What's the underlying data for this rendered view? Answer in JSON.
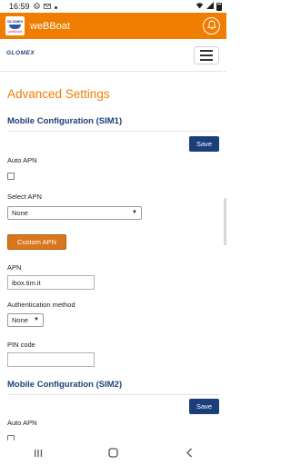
{
  "status_bar": {
    "time": "16:59",
    "notification_icons": [
      "whatsapp-icon",
      "mail-icon",
      "dot-icon"
    ],
    "system_icons": [
      "wifi-icon",
      "signal-icon",
      "battery-icon"
    ]
  },
  "app_bar": {
    "logo_text_top": "GLOMEX",
    "logo_text_bottom": "weBBoat",
    "title": "weBBoat",
    "bell_icon": "bell-icon",
    "color": "#ef7d00"
  },
  "page_header": {
    "brand": "GLOMEX",
    "menu_icon": "hamburger-menu-icon"
  },
  "page": {
    "title": "Advanced Settings",
    "sim1": {
      "title": "Mobile Configuration (SIM1)",
      "save_label": "Save",
      "auto_apn_label": "Auto APN",
      "auto_apn_checked": false,
      "select_apn_label": "Select APN",
      "select_apn_value": "None",
      "custom_apn_button": "Custom APN",
      "apn_label": "APN",
      "apn_value": "ibox.tim.it",
      "auth_label": "Authentication method",
      "auth_value": "None",
      "pin_label": "PIN code",
      "pin_value": ""
    },
    "sim2": {
      "title": "Mobile Configuration (SIM2)",
      "save_label": "Save",
      "auto_apn_label": "Auto APN",
      "auto_apn_checked": false
    }
  },
  "nav_bar": {
    "icons": [
      "recent-apps-icon",
      "home-icon",
      "back-icon"
    ]
  },
  "colors": {
    "accent": "#ef7d00",
    "primary": "#1b3f7a",
    "custom_apn_button": "#d8771c"
  }
}
